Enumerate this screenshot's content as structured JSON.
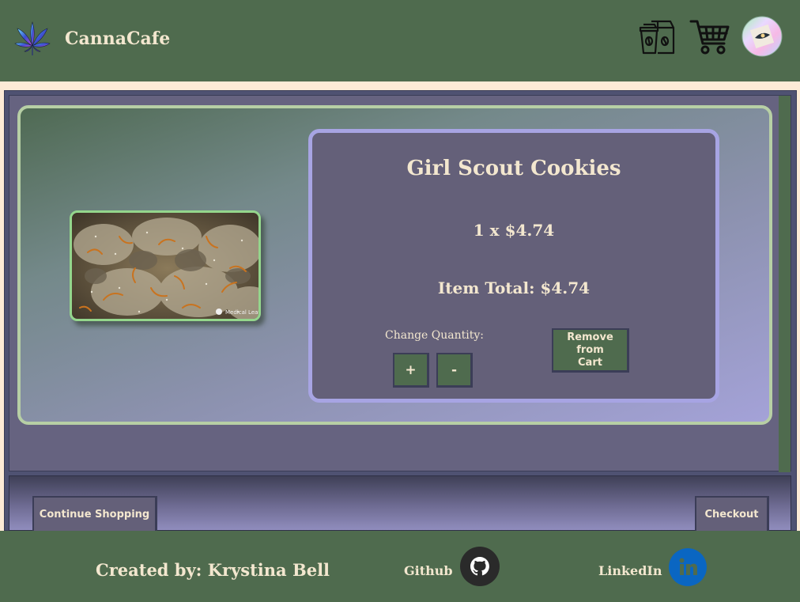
{
  "header": {
    "brand_name": "CannaCafe",
    "icons": [
      "cannabis-leaf-logo",
      "coffee-bag-icon",
      "shopping-cart-icon",
      "profile-avatar"
    ]
  },
  "cart": {
    "item": {
      "name": "Girl Scout Cookies",
      "quantity_line": "1 x $4.74",
      "total_line": "Item Total: $4.74",
      "change_quantity_label": "Change Quantity:",
      "plus_label": "+",
      "minus_label": "-",
      "remove_label": "Remove from Cart",
      "photo_watermark": "Medical Leaf"
    },
    "continue_label": "Continue Shopping",
    "checkout_label": "Checkout"
  },
  "footer": {
    "credit": "Created by: Krystina Bell",
    "github_label": "Github",
    "linkedin_label": "LinkedIn"
  },
  "colors": {
    "header_green": "#4f6b4e",
    "cream_text": "#f3e7cf",
    "panel_purple": "#646079",
    "card_border": "#b7cfa5",
    "details_border": "#a7a4e3",
    "linkedin_blue": "#0a66c2"
  }
}
